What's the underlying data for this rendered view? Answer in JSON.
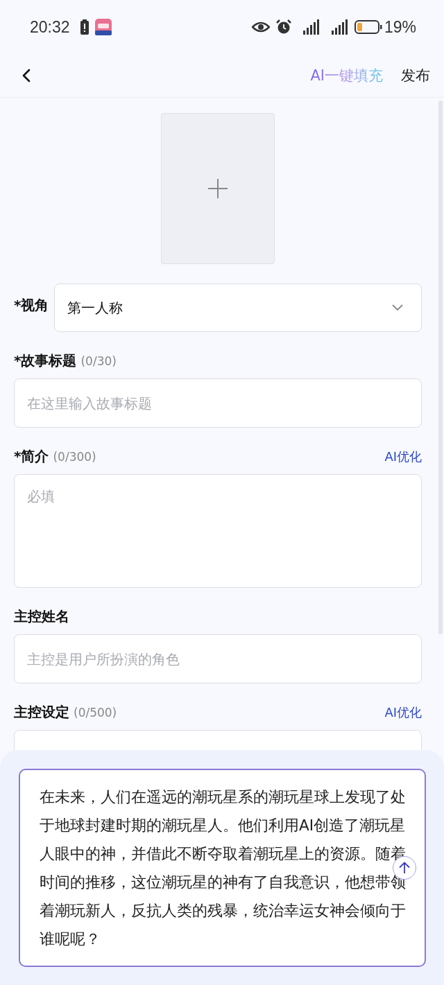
{
  "status_bar": {
    "time": "20:32",
    "battery": "19%"
  },
  "header": {
    "ai_fill": "AI一键填充",
    "publish": "发布"
  },
  "fields": [
    {
      "kind": "select",
      "label": "*视角",
      "value": "第一人称"
    },
    {
      "kind": "input",
      "label": "*故事标题",
      "count": "(0/30)",
      "placeholder": "在这里输入故事标题"
    },
    {
      "kind": "textarea",
      "label": "*简介",
      "count": "(0/300)",
      "action": "AI优化",
      "placeholder": "必填"
    },
    {
      "kind": "input",
      "label": "主控姓名",
      "placeholder": "主控是用户所扮演的角色"
    },
    {
      "kind": "textarea",
      "label": "主控设定",
      "count": "(0/500)",
      "action": "AI优化"
    }
  ],
  "prompt": {
    "value": "在未来，人们在遥远的潮玩星系的潮玩星球上发现了处于地球封建时期的潮玩星人。他们利用AI创造了潮玩星人眼中的神，并借此不断夺取着潮玩星上的资源。随着时间的推移，这位潮玩星的神有了自我意识，他想带领着潮玩新人，反抗人类的残暴，统治幸运女神会倾向于谁呢呢？"
  }
}
